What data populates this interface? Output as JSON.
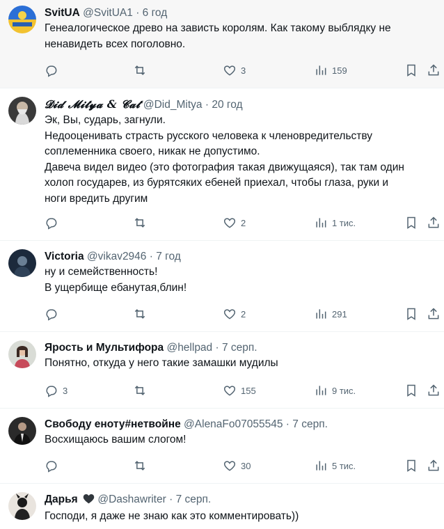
{
  "tweets": [
    {
      "name": "SvitUA",
      "handle": "@SvitUA1",
      "dot": "·",
      "time": "6 год",
      "lines": [
        "Генеалогическое древо на зависть  королям.   Как такому выблядку не",
        "ненавидеть всех поголовно."
      ],
      "replies": "",
      "retweets": "",
      "likes": "3",
      "views": "159",
      "avatar": "ukraine-flag-avatar"
    },
    {
      "name": "𝓓𝓲𝓭 𝓜𝓲𝓽𝔂𝓪 & 𝓒𝓪𝓽",
      "handle": "@Did_Mitya",
      "dot": "·",
      "time": "20 год",
      "lines": [
        "Эк, Вы, сударь, загнули.",
        "Недооценивать страсть русского человека к членовредительству",
        "соплеменника своего, никак не допустимо.",
        "Давеча видел видео (это фотография такая движущаяся), так там один",
        "холоп государев, из бурятсяких ебеней приехал, чтобы глаза, руки и",
        "ноги вредить другим"
      ],
      "replies": "",
      "retweets": "",
      "likes": "2",
      "views": "1 тис.",
      "avatar": "bearded-man-avatar"
    },
    {
      "name": "Victoria",
      "handle": "@vikav2946",
      "dot": "·",
      "time": "7 год",
      "lines": [
        "ну и семейственность!",
        "В ущербище ебанутая,блин!"
      ],
      "replies": "",
      "retweets": "",
      "likes": "2",
      "views": "291",
      "avatar": "night-portrait-avatar"
    },
    {
      "name": "Ярость и Мультифора",
      "handle": "@hellpad",
      "dot": "·",
      "time": "7 серп.",
      "lines": [
        "Понятно, откуда у него такие замашки мудилы"
      ],
      "replies": "3",
      "retweets": "",
      "likes": "155",
      "views": "9 тис.",
      "avatar": "woman-portrait-avatar"
    },
    {
      "name": "Свободу еноту#нетвойне",
      "handle": "@AlenaFo07055545",
      "dot": "·",
      "time": "7 серп.",
      "lines": [
        "Восхищаюсь вашим слогом!"
      ],
      "replies": "",
      "retweets": "",
      "likes": "30",
      "views": "5 тис.",
      "avatar": "man-suit-avatar"
    },
    {
      "name": "Дарья",
      "handle": "@Dashawriter",
      "dot": "·",
      "time": "7 серп.",
      "lines": [
        "Господи, я даже не знаю как это комментировать))"
      ],
      "replies": "",
      "retweets": "",
      "likes": "",
      "views": "",
      "avatar": "dark-figure-avatar"
    }
  ],
  "colors": {
    "text": "#0f1419",
    "muted": "#536471",
    "divider": "#eff3f4",
    "highlight_bg": "#f7f7f7"
  },
  "icons": [
    "reply-icon",
    "retweet-icon",
    "like-icon",
    "views-icon",
    "bookmark-icon",
    "share-icon",
    "heart-emoji-icon"
  ]
}
